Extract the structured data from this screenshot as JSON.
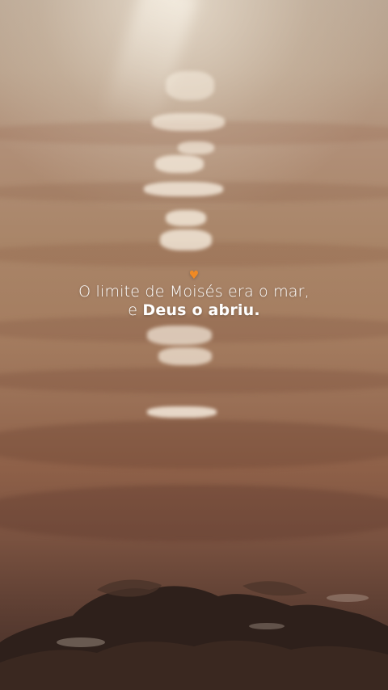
{
  "caption": {
    "icon": "orange-heart-icon",
    "icon_glyph": "♥",
    "line1": "O limite de Moisés era o mar,",
    "line2_prefix": "e ",
    "line2_bold": "Deus o abriu."
  },
  "colors": {
    "heart": "#f08a24",
    "text": "#ffffff"
  }
}
